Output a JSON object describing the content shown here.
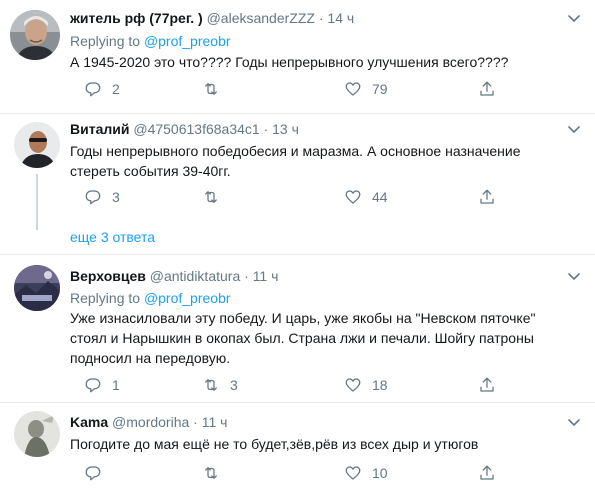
{
  "tweets": [
    {
      "name": "житель рф (77рег. )",
      "handle": "@aleksanderZZZ",
      "dot": "·",
      "time": "14 ч",
      "replying_label": "Replying to",
      "replying_to": "@prof_preobr",
      "text": "А 1945-2020 это что???? Годы непрерывного улучшения всего????",
      "replies": "2",
      "retweets": "",
      "likes": "79"
    },
    {
      "name": "Виталий",
      "handle": "@4750613f68a34c1",
      "dot": "·",
      "time": "13 ч",
      "text": "Годы непрерывного победобесия и маразма. А основное назначение стереть события 39-40гг.",
      "replies": "3",
      "retweets": "",
      "likes": "44"
    },
    {
      "name": "Верховцев",
      "handle": "@antidiktatura",
      "dot": "·",
      "time": "11 ч",
      "replying_label": "Replying to",
      "replying_to": "@prof_preobr",
      "text": "Уже изнасиловали эту победу. И царь, уже якобы на \"Невском пяточке\" стоял и Нарышкин в окопах был. Страна лжи и печали. Шойгу патроны подносил на передовую.",
      "replies": "1",
      "retweets": "3",
      "likes": "18"
    },
    {
      "name": "Kama",
      "handle": "@mordoriha",
      "dot": "·",
      "time": "11 ч",
      "text": "Погодите до мая ещё не то будет,зёв,рёв из всех дыр и утюгов",
      "replies": "",
      "retweets": "",
      "likes": "10"
    }
  ],
  "show_more": "еще 3 ответа",
  "icons": {
    "reply": "reply-icon",
    "retweet": "retweet-icon",
    "like": "heart-icon",
    "share": "share-icon",
    "more": "chevron-down-icon"
  },
  "colors": {
    "link": "#1da1f2",
    "muted": "#657786",
    "text": "#14171a",
    "divider": "#e6ecf0"
  }
}
